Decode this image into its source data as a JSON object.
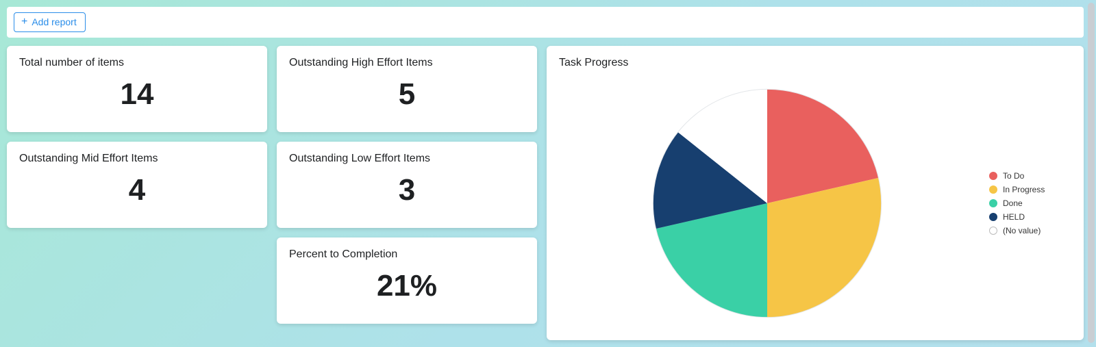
{
  "toolbar": {
    "add_report_label": "Add report"
  },
  "cards": {
    "total_items": {
      "title": "Total number of items",
      "value": "14"
    },
    "high_effort": {
      "title": "Outstanding High Effort Items",
      "value": "5"
    },
    "mid_effort": {
      "title": "Outstanding Mid Effort Items",
      "value": "4"
    },
    "low_effort": {
      "title": "Outstanding Low Effort Items",
      "value": "3"
    },
    "pct_complete": {
      "title": "Percent to Completion",
      "value": "21%"
    }
  },
  "chart": {
    "title": "Task Progress",
    "legend": {
      "todo": "To Do",
      "inprog": "In Progress",
      "done": "Done",
      "held": "HELD",
      "novalue": "(No value)"
    },
    "colors": {
      "todo": "#e9605e",
      "inprog": "#f6c546",
      "done": "#3ad0a6",
      "held": "#173f6f",
      "novalue": "#ffffff"
    }
  },
  "chart_data": {
    "type": "pie",
    "title": "Task Progress",
    "categories": [
      "To Do",
      "In Progress",
      "Done",
      "HELD",
      "(No value)"
    ],
    "values": [
      3,
      4,
      3,
      2,
      2
    ],
    "colors": [
      "#e9605e",
      "#f6c546",
      "#3ad0a6",
      "#173f6f",
      "#ffffff"
    ]
  }
}
